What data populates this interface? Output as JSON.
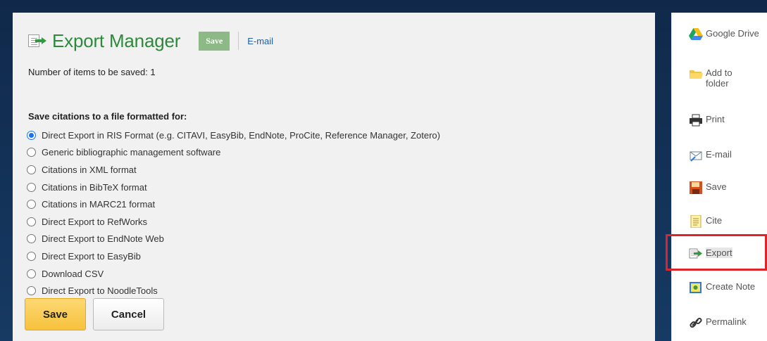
{
  "header": {
    "title": "Export Manager",
    "save_label": "Save",
    "email_label": "E-mail"
  },
  "count_text": "Number of items to be saved: 1",
  "section_label": "Save citations to a file formatted for:",
  "options": [
    {
      "label": "Direct Export in RIS Format (e.g. CITAVI, EasyBib, EndNote, ProCite, Reference Manager, Zotero)",
      "checked": true
    },
    {
      "label": "Generic bibliographic management software",
      "checked": false
    },
    {
      "label": "Citations in XML format",
      "checked": false
    },
    {
      "label": "Citations in BibTeX format",
      "checked": false
    },
    {
      "label": "Citations in MARC21 format",
      "checked": false
    },
    {
      "label": "Direct Export to RefWorks",
      "checked": false
    },
    {
      "label": "Direct Export to EndNote Web",
      "checked": false
    },
    {
      "label": "Direct Export to EasyBib",
      "checked": false
    },
    {
      "label": "Download CSV",
      "checked": false
    },
    {
      "label": "Direct Export to NoodleTools",
      "checked": false
    }
  ],
  "actions": {
    "save_label": "Save",
    "cancel_label": "Cancel"
  },
  "sidebar": {
    "google_drive": "Google Drive",
    "add_to_folder": "Add to folder",
    "print": "Print",
    "email": "E-mail",
    "save": "Save",
    "cite": "Cite",
    "export": "Export",
    "create_note": "Create Note",
    "permalink": "Permalink"
  },
  "colors": {
    "title_green": "#2d8a3b",
    "link_blue": "#1e5fa8",
    "save_yellow": "#f7c23c",
    "highlight_red": "#d9262b"
  }
}
